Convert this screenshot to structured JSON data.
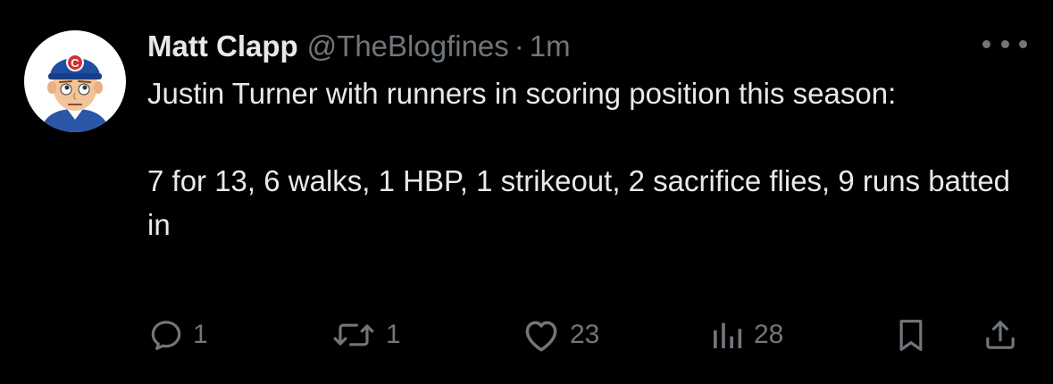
{
  "tweet": {
    "author_name": "Matt Clapp",
    "handle": "@TheBlogfines",
    "separator": "·",
    "time": "1m",
    "avatar_icon": "bitmoji-avatar-cubs-cap",
    "more_icon": "more-horizontal-icon",
    "text_paragraphs": [
      "Justin Turner with runners in scoring position this season:",
      "7 for 13, 6 walks, 1 HBP, 1 strikeout, 2 sacrifice flies, 9 runs batted in"
    ]
  },
  "actions": {
    "reply": {
      "icon": "reply-icon",
      "count": "1"
    },
    "repost": {
      "icon": "repost-icon",
      "count": "1"
    },
    "like": {
      "icon": "heart-icon",
      "count": "23"
    },
    "views": {
      "icon": "views-chart-icon",
      "count": "28"
    },
    "bookmark": {
      "icon": "bookmark-icon"
    },
    "share": {
      "icon": "share-icon"
    }
  },
  "colors": {
    "background": "#000000",
    "primary_text": "#e7e9ea",
    "secondary_text": "#71767b",
    "cubs_blue": "#1f4fa0",
    "cubs_red": "#cc3433"
  }
}
